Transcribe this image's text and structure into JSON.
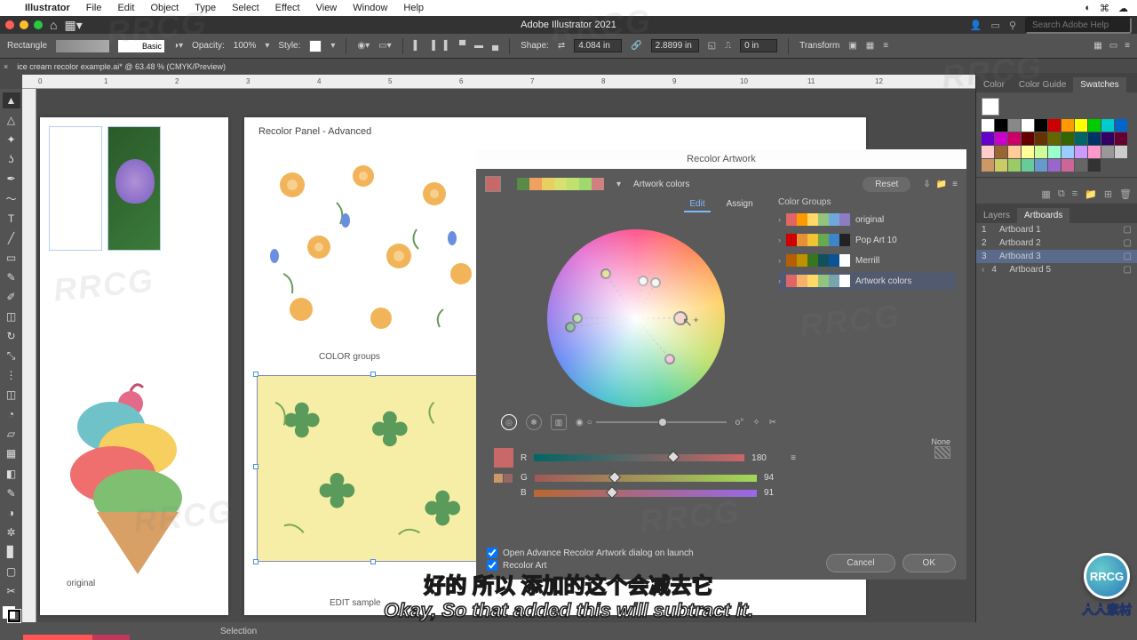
{
  "menubar": {
    "apple": "",
    "app": "Illustrator",
    "items": [
      "File",
      "Edit",
      "Object",
      "Type",
      "Select",
      "Effect",
      "View",
      "Window",
      "Help"
    ]
  },
  "window": {
    "title": "Adobe Illustrator 2021",
    "search_ph": "Search Adobe Help"
  },
  "control": {
    "tool": "Rectangle",
    "stroke_label": "Basic",
    "opacity_label": "Opacity:",
    "opacity": "100%",
    "style_label": "Style:",
    "shape_label": "Shape:",
    "w": "4.084 in",
    "h": "2.8899 in",
    "xy": "0 in",
    "transform": "Transform"
  },
  "doc_tab": "ice cream recolor example.ai* @ 63.48 % (CMYK/Preview)",
  "ruler_marks": [
    "0",
    "1",
    "2",
    "3",
    "4",
    "5",
    "6",
    "7",
    "8",
    "9",
    "10",
    "11",
    "12"
  ],
  "ab1": {
    "label": "original"
  },
  "ab2": {
    "heading": "Recolor Panel - Advanced",
    "cg": "COLOR groups",
    "edit": "EDIT sample"
  },
  "recolor": {
    "title": "Recolor Artwork",
    "artwork_colors": "Artwork colors",
    "reset": "Reset",
    "edit": "Edit",
    "assign": "Assign",
    "groups_header": "Color Groups",
    "groups": [
      {
        "name": "original",
        "colors": [
          "#e06666",
          "#ff9900",
          "#ffd966",
          "#93c47d",
          "#6fa8dc",
          "#8e7cc3",
          "#c27ba0"
        ]
      },
      {
        "name": "Pop Art 10",
        "colors": [
          "#cc0000",
          "#e69138",
          "#f1c232",
          "#6aa84f",
          "#3d85c6",
          "#674ea7",
          "#222"
        ]
      },
      {
        "name": "Merrill",
        "colors": [
          "#b45f06",
          "#bf9000",
          "#38761d",
          "#134f5c",
          "#0b5394",
          "#fff"
        ]
      },
      {
        "name": "Artwork colors",
        "colors": [
          "#e06666",
          "#f6b26b",
          "#ffd966",
          "#93c47d",
          "#76a5af",
          "#fff"
        ]
      }
    ],
    "active_swatch": "#c96868",
    "palette": [
      "#5a8a4a",
      "#f0a060",
      "#e8d060",
      "#d8e070",
      "#c0e070",
      "#a0d870",
      "#d08080"
    ],
    "rgb": {
      "R": "R",
      "G": "G",
      "B": "B",
      "r": "180",
      "g": "94",
      "b": "91"
    },
    "none": "None",
    "open_launch": "Open Advance Recolor Artwork dialog on launch",
    "recolor_art": "Recolor Art",
    "cancel": "Cancel",
    "ok": "OK"
  },
  "rpanel": {
    "top_tabs": [
      "Color",
      "Color Guide",
      "Swatches"
    ],
    "mid_tabs": [
      "Layers",
      "Artboards"
    ],
    "artboards": [
      {
        "n": "1",
        "name": "Artboard 1"
      },
      {
        "n": "2",
        "name": "Artboard 2"
      },
      {
        "n": "3",
        "name": "Artboard 3"
      },
      {
        "n": "4",
        "name": "Artboard 5"
      }
    ],
    "swatch_rows": [
      [
        "#fff",
        "#000",
        "#888"
      ],
      [
        "#fff",
        "#000",
        "#c00",
        "#f90",
        "#ff0",
        "#0c0",
        "#0cc",
        "#06c",
        "#60c",
        "#c0c",
        "#c06"
      ],
      [
        "#600",
        "#630",
        "#660",
        "#360",
        "#066",
        "#036",
        "#306",
        "#603",
        "#fcc",
        "#963"
      ],
      [
        "#fc9",
        "#ff9",
        "#cf9",
        "#9fc",
        "#9cf",
        "#c9f",
        "#f9c",
        "#999",
        "#ccc"
      ],
      [
        "#c96",
        "#cc6",
        "#9c6",
        "#6c9",
        "#69c",
        "#96c",
        "#c69",
        "#666",
        "#333"
      ]
    ]
  },
  "status": {
    "sel": "Selection"
  },
  "subtitle": {
    "cn": "好的 所以 添加的这个会减去它",
    "en": "Okay, So that added this will subtract it."
  },
  "watermark": {
    "text": "RRCG",
    "brand": "RRCG",
    "sub": "人人素材"
  }
}
